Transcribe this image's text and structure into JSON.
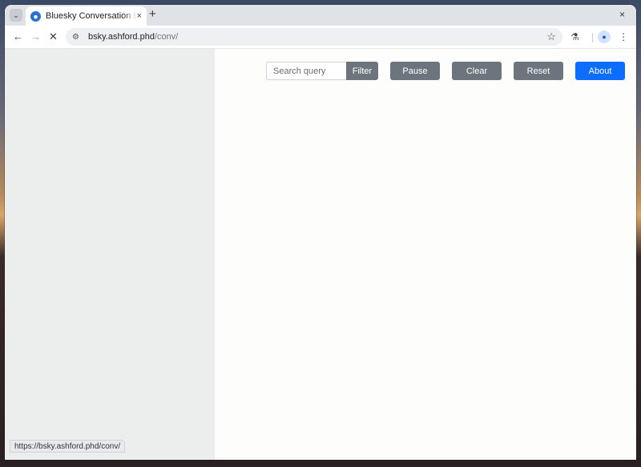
{
  "browser": {
    "tab_title": "Bluesky Conversation Explorer",
    "tab_close": "×",
    "new_tab": "+",
    "window_close": "×",
    "url_host": "bsky.ashford.phd",
    "url_path": "/conv/",
    "status_url": "https://bsky.ashford.phd/conv/"
  },
  "controls": {
    "search_placeholder": "Search query",
    "search_value": "",
    "filter_label": "Filter",
    "pause_label": "Pause",
    "clear_label": "Clear",
    "reset_label": "Reset",
    "about_label": "About"
  },
  "colors": {
    "secondary_button": "#6c757d",
    "primary_button": "#0d6efd",
    "sidebar_bg": "#eceeee"
  }
}
